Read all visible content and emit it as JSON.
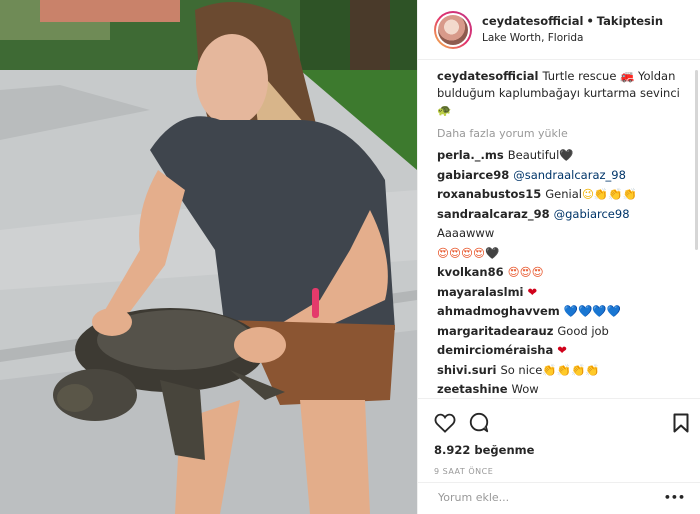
{
  "post": {
    "username": "ceydatesofficial",
    "follow_status": "Takiptesin",
    "location": "Lake Worth, Florida",
    "caption_user": "ceydatesofficial",
    "caption_text": "Turtle rescue 🚒 Yoldan bulduğum kaplumbağayı kurtarma sevinci 🐢",
    "load_more": "Daha fazla yorum yükle",
    "likes": "8.922 beğenme",
    "time_ago": "9 SAAT ÖNCE",
    "comment_placeholder": "Yorum ekle...",
    "options": "•••"
  },
  "comments": [
    {
      "user": "perla._.ms",
      "text": "Beautiful",
      "emoji": "🖤",
      "emoji_class": "emoji-k"
    },
    {
      "user": "gabiarce98",
      "mention": "@sandraalcaraz_98",
      "text": ""
    },
    {
      "user": "roxanabustos15",
      "text": "Genial",
      "emoji": "😉👏👏👏",
      "emoji_class": "emoji-y"
    },
    {
      "user": "sandraalcaraz_98",
      "mention": "@gabiarce98",
      "text": "Aaaawww"
    },
    {
      "user": "",
      "text": "",
      "emoji": "😍😍😍😍🖤",
      "emoji_class": "emoji-o"
    },
    {
      "user": "kvolkan86",
      "text": "",
      "emoji": "😍😍😍",
      "emoji_class": "emoji-o"
    },
    {
      "user": "mayaralaslmi",
      "text": "",
      "emoji": "❤",
      "emoji_class": "emoji-r"
    },
    {
      "user": "ahmadmoghavvem",
      "text": "",
      "emoji": "💙💙💙💙",
      "emoji_class": "emoji-b"
    },
    {
      "user": "margaritadearauz",
      "text": "Good job"
    },
    {
      "user": "demircioméraisha",
      "text": "",
      "emoji": "❤",
      "emoji_class": "emoji-r"
    },
    {
      "user": "shivi.suri",
      "text": "So nice",
      "emoji": "👏👏👏👏",
      "emoji_class": "emoji-y"
    },
    {
      "user": "zeetashine",
      "text": "Wow"
    }
  ],
  "icons": [
    "heart-icon",
    "comment-icon",
    "bookmark-icon"
  ]
}
